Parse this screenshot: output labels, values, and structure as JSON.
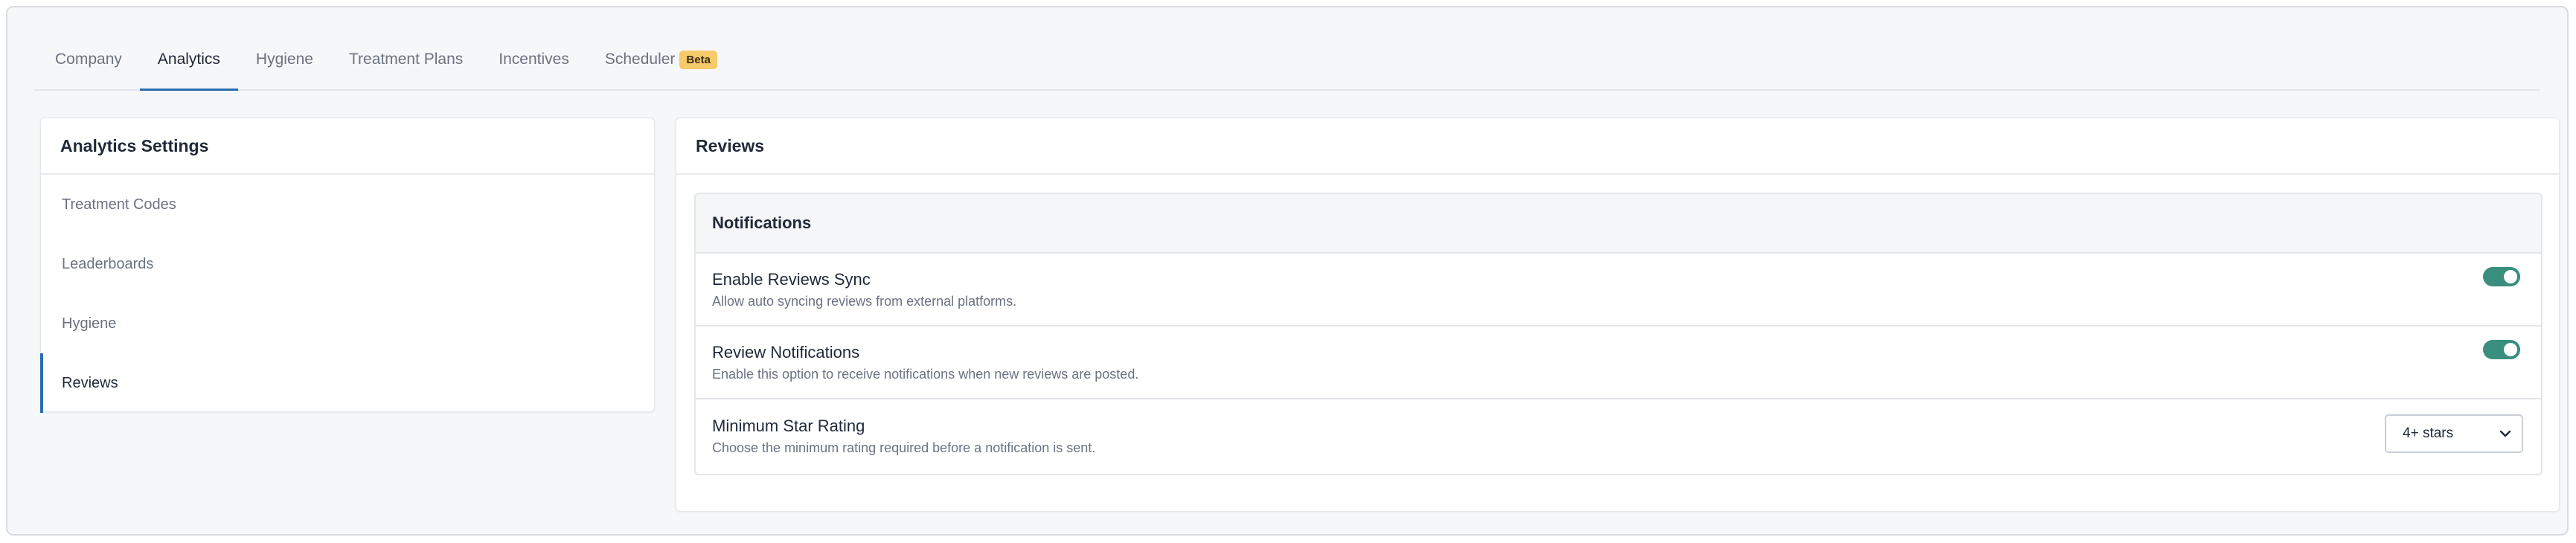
{
  "tabs": [
    {
      "label": "Company"
    },
    {
      "label": "Analytics"
    },
    {
      "label": "Hygiene"
    },
    {
      "label": "Treatment Plans"
    },
    {
      "label": "Incentives"
    },
    {
      "label": "Scheduler",
      "badge": "Beta"
    }
  ],
  "active_tab": "Analytics",
  "sidebar": {
    "title": "Analytics Settings",
    "items": [
      {
        "label": "Treatment Codes"
      },
      {
        "label": "Leaderboards"
      },
      {
        "label": "Hygiene"
      },
      {
        "label": "Reviews"
      }
    ],
    "active_item": "Reviews"
  },
  "main": {
    "title": "Reviews",
    "section_title": "Notifications",
    "settings": [
      {
        "title": "Enable Reviews Sync",
        "description": "Allow auto syncing reviews from external platforms.",
        "enabled": true
      },
      {
        "title": "Review Notifications",
        "description": "Enable this option to receive notifications when new reviews are posted.",
        "enabled": true
      },
      {
        "title": "Minimum Star Rating",
        "description": "Choose the minimum rating required before a notification is sent.",
        "selected": "4+ stars"
      }
    ]
  },
  "colors": {
    "accent": "#2b6cb0",
    "toggle_on": "#3a8e7d",
    "badge": "#f6c969"
  },
  "icons": {
    "select_caret": "chevron-down-icon"
  }
}
